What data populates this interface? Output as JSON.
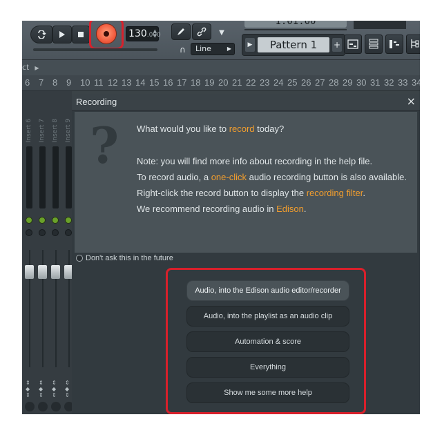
{
  "toolbar": {
    "loop_icon": "loop-icon",
    "play_icon": "play-icon",
    "stop_icon": "stop-icon",
    "tempo_int": "130",
    "tempo_dec": ".000",
    "snap": "Line",
    "time": "1:01:00",
    "pattern": "Pattern 1",
    "pattern_add": "+"
  },
  "breadcrumb": {
    "text": "ct"
  },
  "ruler": [
    "6",
    "7",
    "8",
    "9",
    "10",
    "11",
    "12",
    "13",
    "14",
    "15",
    "16",
    "17",
    "18",
    "19",
    "20",
    "21",
    "22",
    "23",
    "24",
    "25",
    "26",
    "27",
    "28",
    "29",
    "30",
    "31",
    "32",
    "33",
    "34"
  ],
  "mixer": {
    "strips": [
      "Insert 6",
      "Insert 7",
      "Insert 8",
      "Insert 9"
    ]
  },
  "dialog": {
    "title": "Recording",
    "close": "×",
    "question_mark": "?",
    "q_pre": "What would you like to ",
    "q_link": "record",
    "q_post": " today?",
    "line1": "Note: you will find more info about recording in the help file.",
    "line2_pre": "To record audio, a ",
    "line2_link": "one-click",
    "line2_post": " audio recording button is also available.",
    "line3_pre": "Right-click the record button to display the ",
    "line3_link": "recording filter",
    "line3_post": ".",
    "line4_pre": "We recommend recording audio in ",
    "line4_link": "Edison",
    "line4_post": ".",
    "dont_ask": "Don't ask this in the future",
    "options": [
      "Audio, into the Edison audio editor/recorder",
      "Audio, into the playlist as an audio clip",
      "Automation & score",
      "Everything",
      "Show me some more help"
    ]
  },
  "colors": {
    "accent_link": "#f29e2e",
    "highlight": "#d8202b",
    "record": "#f15b3e"
  }
}
